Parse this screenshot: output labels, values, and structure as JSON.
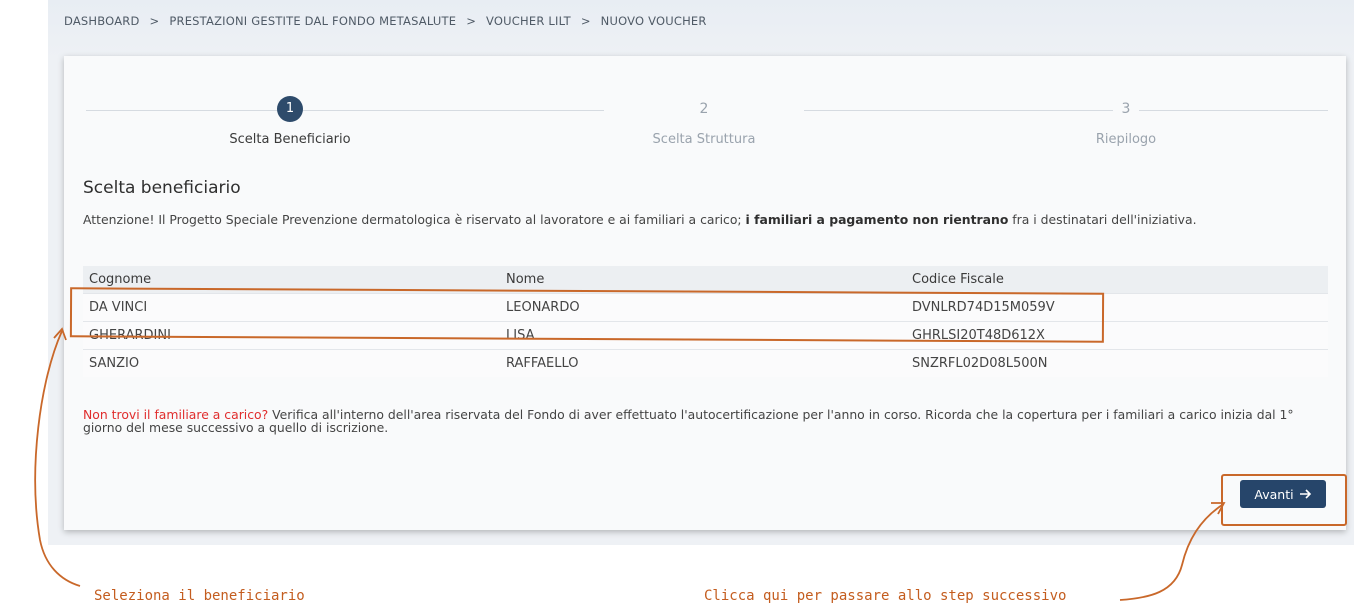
{
  "breadcrumb": {
    "items": [
      "DASHBOARD",
      "PRESTAZIONI GESTITE DAL FONDO METASALUTE",
      "VOUCHER LILT",
      "NUOVO VOUCHER"
    ],
    "separator": ">"
  },
  "stepper": {
    "steps": [
      {
        "number": "1",
        "label": "Scelta Beneficiario",
        "active": true
      },
      {
        "number": "2",
        "label": "Scelta Struttura",
        "active": false
      },
      {
        "number": "3",
        "label": "Riepilogo",
        "active": false
      }
    ]
  },
  "section": {
    "title": "Scelta beneficiario",
    "warning_part1": "Attenzione! Il Progetto Speciale Prevenzione dermatologica è riservato al lavoratore e ai familiari a carico;",
    "warning_bold": "i familiari a pagamento non rientrano",
    "warning_part2": "fra i destinatari dell'iniziativa."
  },
  "table": {
    "headers": [
      "Cognome",
      "Nome",
      "Codice Fiscale"
    ],
    "rows": [
      [
        "DA VINCI",
        "LEONARDO",
        "DVNLRD74D15M059V"
      ],
      [
        "GHERARDINI",
        "LISA",
        "GHRLSI20T48D612X"
      ],
      [
        "SANZIO",
        "RAFFAELLO",
        "SNZRFL02D08L500N"
      ]
    ]
  },
  "info": {
    "alert": "Non trovi il familiare a carico?",
    "text": "Verifica all'interno dell'area riservata del Fondo di aver effettuato l'autocertificazione per l'anno in corso. Ricorda che la copertura per i familiari a carico inizia dal 1° giorno del mese successivo a quello di iscrizione."
  },
  "actions": {
    "next_label": "Avanti",
    "next_icon": "arrow-right-icon"
  },
  "annotations": {
    "select_beneficiary": "Seleziona il beneficiario",
    "click_next": "Clicca qui per passare allo step successivo",
    "color": "#c9682a"
  },
  "colors": {
    "primary": "#26456a",
    "alert": "#e02d2d",
    "annotation": "#c9682a"
  }
}
